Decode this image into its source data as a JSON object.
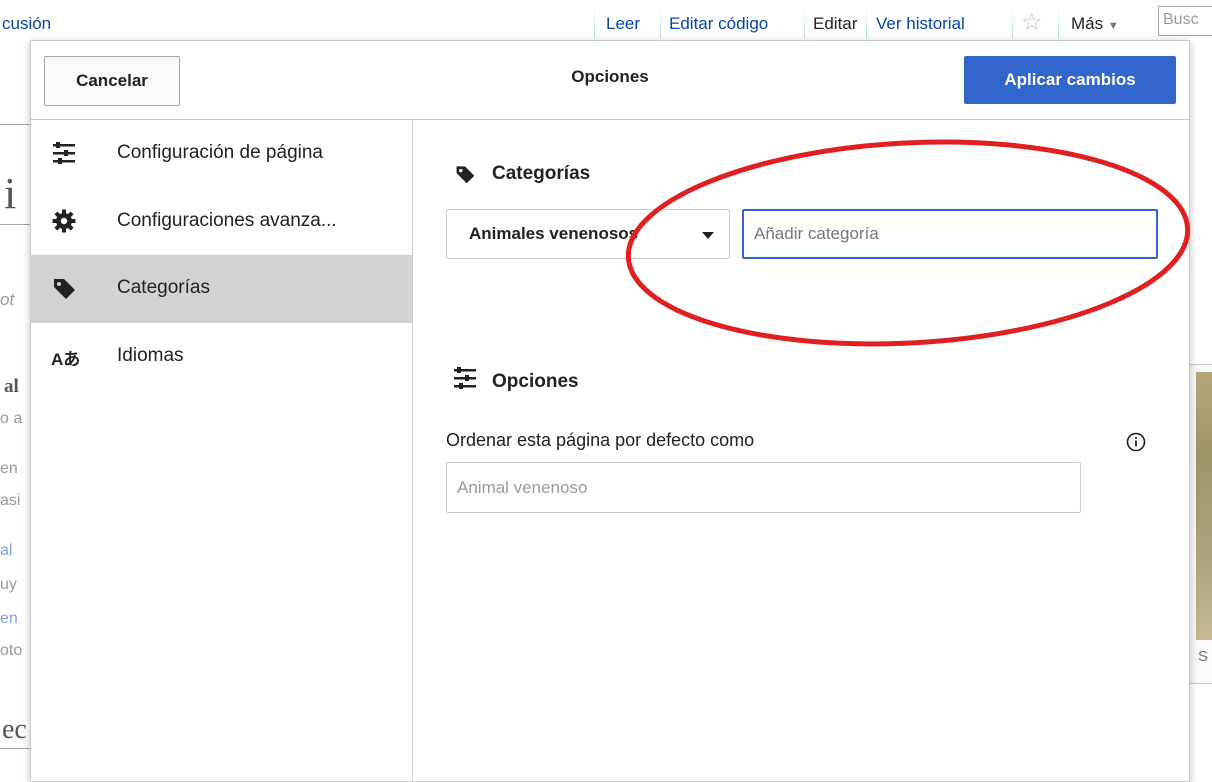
{
  "background": {
    "tabs": [
      {
        "label": "cusión"
      },
      {
        "label": "Leer"
      },
      {
        "label": "Editar código"
      },
      {
        "label": "Editar"
      },
      {
        "label": "Ver historial"
      },
      {
        "label": "Más"
      }
    ],
    "search_placeholder": "Busc",
    "fragments": [
      "i",
      "ot",
      "al",
      "o a",
      "en",
      "asi",
      "al",
      "uy",
      "en",
      "oto",
      "ec"
    ],
    "image_caption": "S"
  },
  "dialog": {
    "title": "Opciones",
    "cancel_label": "Cancelar",
    "apply_label": "Aplicar cambios",
    "sidebar": [
      {
        "label": "Configuración de página",
        "icon": "page-settings-icon"
      },
      {
        "label": "Configuraciones avanza...",
        "icon": "gear-icon"
      },
      {
        "label": "Categorías",
        "icon": "tag-icon",
        "active": true
      },
      {
        "label": "Idiomas",
        "icon": "language-icon",
        "icon_text": "Aあ"
      }
    ],
    "categories": {
      "title": "Categorías",
      "chip_label": "Animales venenosos",
      "add_placeholder": "Añadir categoría"
    },
    "options": {
      "title": "Opciones",
      "sort_label": "Ordenar esta página por defecto como",
      "sort_placeholder": "Animal venenoso"
    }
  },
  "colors": {
    "accent": "#3366cc",
    "annotation": "#e02020",
    "active_item": "#d2d2d2"
  }
}
